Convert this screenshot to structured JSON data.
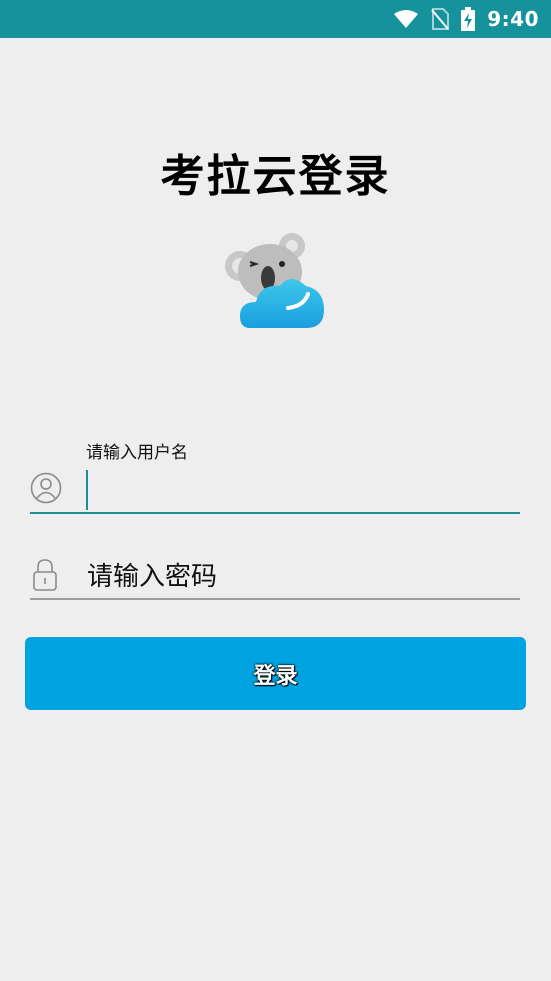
{
  "status_bar": {
    "time": "9:40",
    "icons": [
      "wifi-icon",
      "no-sim-icon",
      "battery-charging-icon"
    ],
    "background": "#16929c"
  },
  "page": {
    "title": "考拉云登录",
    "logo": "koala-cloud-logo"
  },
  "form": {
    "username": {
      "label": "请输入用户名",
      "value": "",
      "icon": "user-icon"
    },
    "password": {
      "placeholder": "请输入密码",
      "icon": "lock-icon"
    }
  },
  "login_button": {
    "label": "登录",
    "color": "#00a3e0"
  }
}
